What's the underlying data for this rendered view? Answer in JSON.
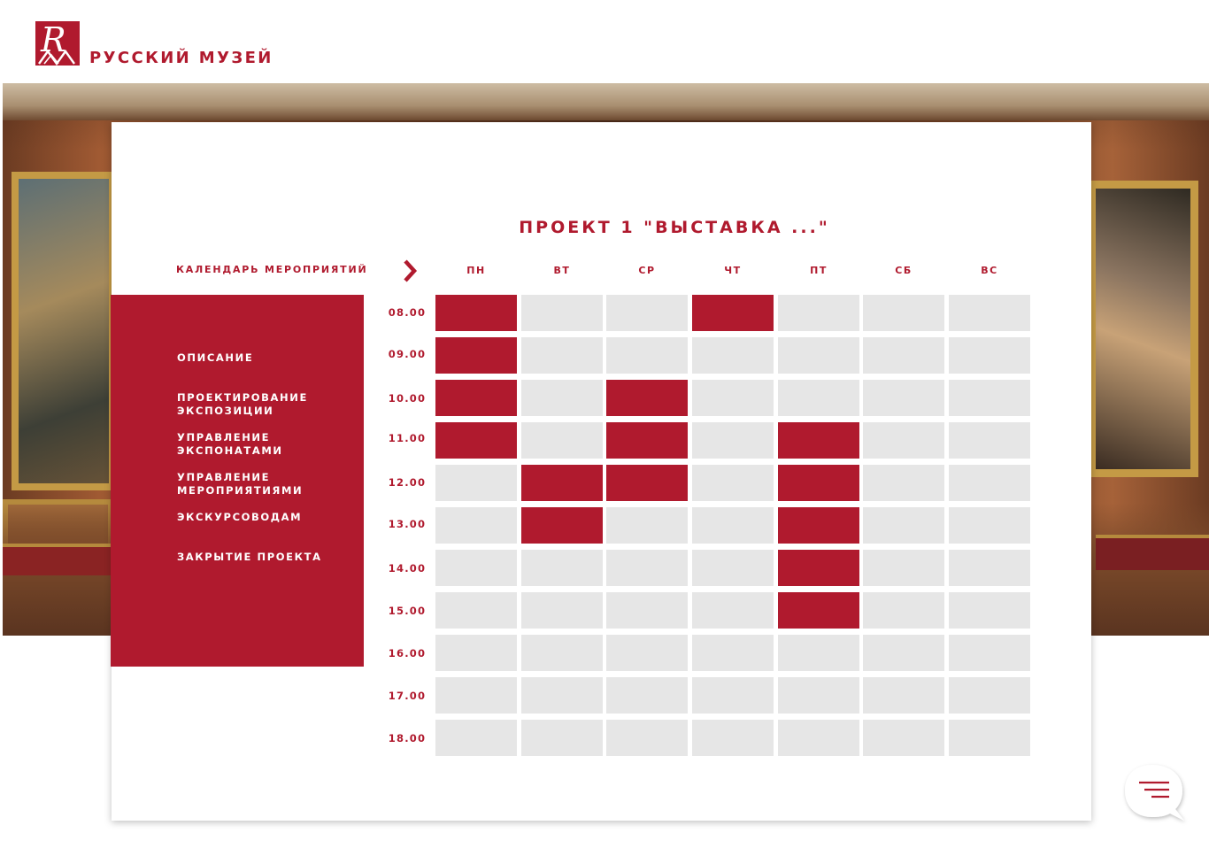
{
  "brand": {
    "name": "РУССКИЙ МУЗЕЙ"
  },
  "colors": {
    "accent": "#b01a2e",
    "cell_free": "#e6e6e6",
    "cell_busy": "#b01a2e"
  },
  "project": {
    "title": "ПРОЕКТ 1 \"ВЫСТАВКА ...\""
  },
  "calendar": {
    "label": "КАЛЕНДАРЬ МЕРОПРИЯТИЙ",
    "days": [
      "ПН",
      "ВТ",
      "СР",
      "ЧТ",
      "ПТ",
      "СБ",
      "ВС"
    ],
    "times": [
      "08.00",
      "09.00",
      "10.00",
      "11.00",
      "12.00",
      "13.00",
      "14.00",
      "15.00",
      "16.00",
      "17.00",
      "18.00"
    ],
    "busy": [
      [
        1,
        0,
        0,
        1,
        0,
        0,
        0
      ],
      [
        1,
        0,
        0,
        0,
        0,
        0,
        0
      ],
      [
        1,
        0,
        1,
        0,
        0,
        0,
        0
      ],
      [
        1,
        0,
        1,
        0,
        1,
        0,
        0
      ],
      [
        0,
        1,
        1,
        0,
        1,
        0,
        0
      ],
      [
        0,
        1,
        0,
        0,
        1,
        0,
        0
      ],
      [
        0,
        0,
        0,
        0,
        1,
        0,
        0
      ],
      [
        0,
        0,
        0,
        0,
        1,
        0,
        0
      ],
      [
        0,
        0,
        0,
        0,
        0,
        0,
        0
      ],
      [
        0,
        0,
        0,
        0,
        0,
        0,
        0
      ],
      [
        0,
        0,
        0,
        0,
        0,
        0,
        0
      ]
    ]
  },
  "menu": [
    {
      "label": "ОПИСАНИЕ"
    },
    {
      "label": "ПРОЕКТИРОВАНИЕ ЭКСПОЗИЦИИ"
    },
    {
      "label": "УПРАВЛЕНИЕ ЭКСПОНАТАМИ"
    },
    {
      "label": "УПРАВЛЕНИЕ МЕРОПРИЯТИЯМИ"
    },
    {
      "label": "ЭКСКУРСОВОДАМ"
    },
    {
      "label": "ЗАКРЫТИЕ ПРОЕКТА"
    }
  ],
  "icons": {
    "logo": "russian-museum-logo",
    "next": "chevron-right-icon",
    "chat": "chat-menu-icon"
  }
}
